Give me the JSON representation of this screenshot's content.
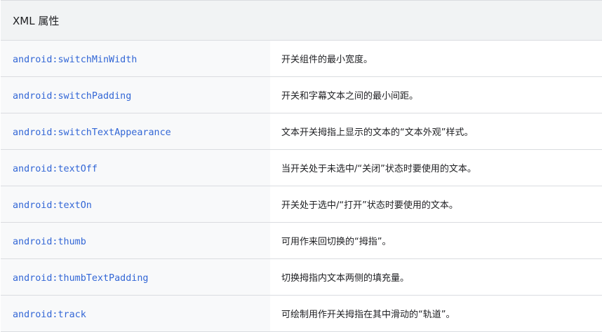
{
  "table": {
    "header": "XML 属性",
    "rows": [
      {
        "attr": "android:switchMinWidth",
        "desc": "开关组件的最小宽度。"
      },
      {
        "attr": "android:switchPadding",
        "desc": "开关和字幕文本之间的最小间距。"
      },
      {
        "attr": "android:switchTextAppearance",
        "desc": "文本开关拇指上显示的文本的“文本外观”样式。"
      },
      {
        "attr": "android:textOff",
        "desc": "当开关处于未选中/“关闭”状态时要使用的文本。"
      },
      {
        "attr": "android:textOn",
        "desc": "开关处于选中/“打开”状态时要使用的文本。"
      },
      {
        "attr": "android:thumb",
        "desc": "可用作来回切换的“拇指”。"
      },
      {
        "attr": "android:thumbTextPadding",
        "desc": "切换拇指内文本两侧的填充量。"
      },
      {
        "attr": "android:track",
        "desc": "可绘制用作开关拇指在其中滑动的“轨道”。"
      }
    ]
  },
  "colors": {
    "header_bg": "#f1f3f4",
    "attr_bg": "#f8f9fa",
    "link": "#3367d6",
    "border": "#dadce0",
    "text": "#202124"
  }
}
